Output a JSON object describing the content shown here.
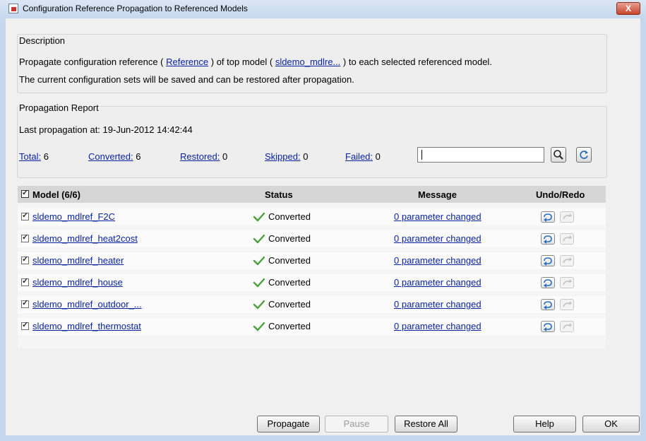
{
  "window": {
    "title": "Configuration Reference Propagation to Referenced Models",
    "close_label": "X"
  },
  "description": {
    "group_title": "Description",
    "line1_pre": "Propagate configuration reference (",
    "reference_link": "Reference",
    "line1_mid": ") of top model (",
    "model_link": "sldemo_mdlre...",
    "line1_post": ") to each selected referenced model.",
    "line2": "The current configuration sets will be saved and can be restored after propagation."
  },
  "report": {
    "group_title": "Propagation Report",
    "last_propagation": "Last propagation at: 19-Jun-2012 14:42:44",
    "stats": [
      {
        "label": "Total:",
        "value": "6"
      },
      {
        "label": "Converted:",
        "value": "6"
      },
      {
        "label": "Restored:",
        "value": "0"
      },
      {
        "label": "Skipped:",
        "value": "0"
      },
      {
        "label": "Failed:",
        "value": "0"
      }
    ],
    "search_value": ""
  },
  "table": {
    "headers": {
      "model": "Model (6/6)",
      "status": "Status",
      "message": "Message",
      "undo_redo": "Undo/Redo"
    },
    "rows": [
      {
        "model": "sldemo_mdlref_F2C",
        "status": "Converted",
        "message": "0 parameter changed"
      },
      {
        "model": "sldemo_mdlref_heat2cost",
        "status": "Converted",
        "message": "0 parameter changed"
      },
      {
        "model": "sldemo_mdlref_heater",
        "status": "Converted",
        "message": "0 parameter changed"
      },
      {
        "model": "sldemo_mdlref_house",
        "status": "Converted",
        "message": "0 parameter changed"
      },
      {
        "model": "sldemo_mdlref_outdoor_...",
        "status": "Converted",
        "message": "0 parameter changed"
      },
      {
        "model": "sldemo_mdlref_thermostat",
        "status": "Converted",
        "message": "0 parameter changed"
      }
    ]
  },
  "buttons": {
    "propagate": "Propagate",
    "pause": "Pause",
    "restore_all": "Restore All",
    "help": "Help",
    "ok": "OK"
  },
  "colors": {
    "link": "#0a23a0",
    "check_green": "#4aa03a",
    "header_bg": "#d6d6d6"
  }
}
